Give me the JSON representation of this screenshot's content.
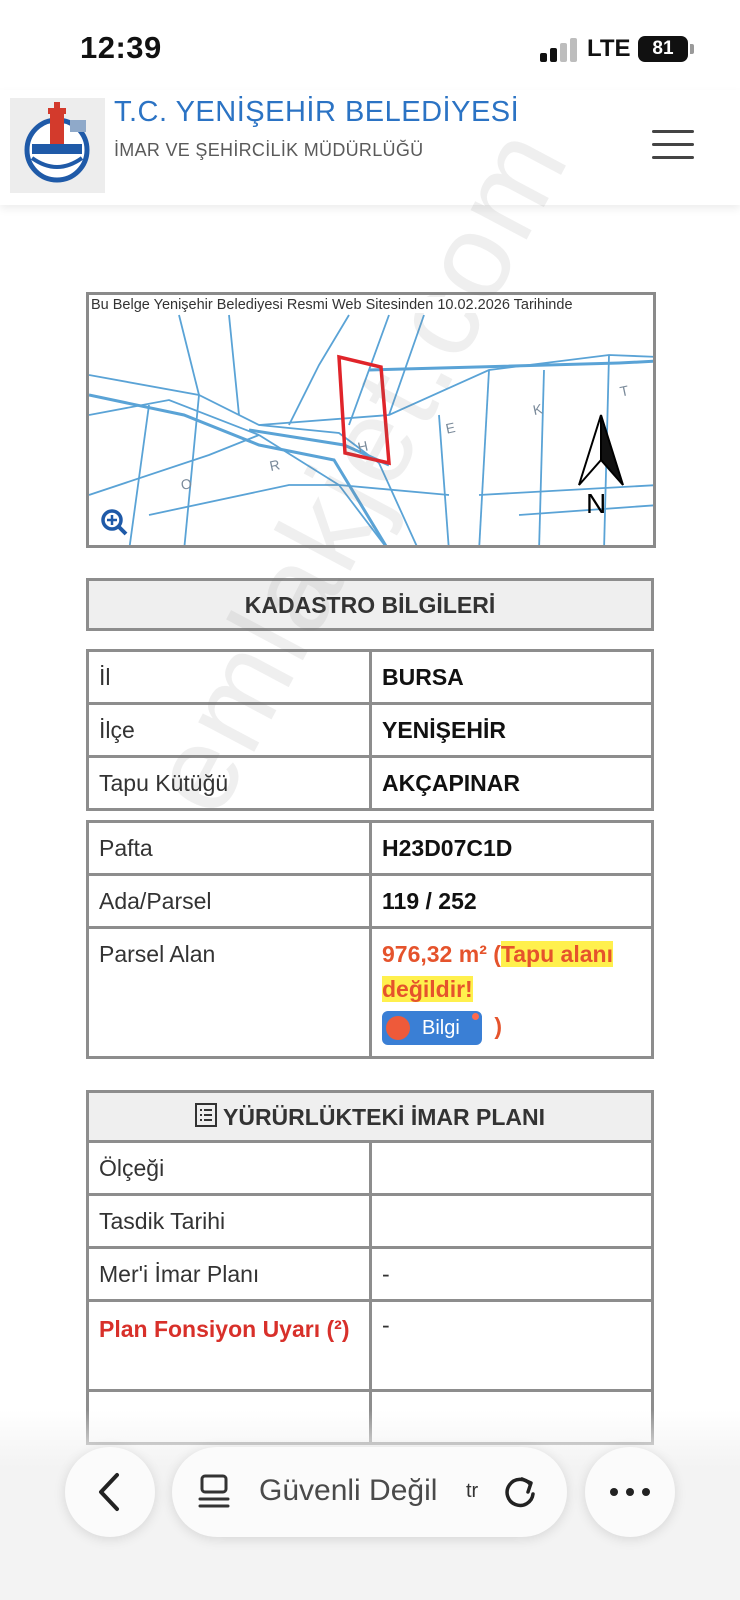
{
  "status_bar": {
    "time": "12:39",
    "network": "LTE",
    "battery": "81",
    "icons": [
      "signal-icon",
      "battery-icon"
    ]
  },
  "header": {
    "org_name": "T.C. YENİŞEHİR BELEDİYESİ",
    "org_sub": "İMAR VE ŞEHİRCİLİK MÜDÜRLÜĞÜ",
    "logo_text": "T.C. YENİŞEHİR BELEDİYESİ",
    "icons": [
      "logo-icon",
      "hamburger-menu-icon"
    ]
  },
  "map": {
    "caption": "Bu Belge Yenişehir Belediyesi Resmi Web Sitesinden 10.02.2026 Tarihinde",
    "north_label": "N",
    "road_label": "O R H E K T",
    "icons": [
      "zoom-in-icon",
      "north-arrow-icon"
    ]
  },
  "kadastro": {
    "title": "KADASTRO BİLGİLERİ",
    "location_rows": [
      {
        "label": "İl",
        "value": "BURSA"
      },
      {
        "label": "İlçe",
        "value": "YENİŞEHİR"
      },
      {
        "label": "Tapu Kütüğü",
        "value": "AKÇAPINAR"
      }
    ],
    "parcel_rows": [
      {
        "label": "Pafta",
        "value": "H23D07C1D"
      },
      {
        "label": "Ada/Parsel",
        "value": "119 / 252"
      }
    ],
    "area": {
      "label": "Parsel Alan",
      "value": "976,32 m²",
      "open_paren": "(",
      "note": "Tapu alanı değildir!",
      "button_label": "Bilgi",
      "close_paren": ")"
    }
  },
  "imar": {
    "title": "YÜRÜRLÜKTEKİ İMAR PLANI",
    "rows": [
      {
        "label": "Ölçeği",
        "value": ""
      },
      {
        "label": "Tasdik Tarihi",
        "value": ""
      },
      {
        "label": "Mer'i İmar Planı",
        "value": "-"
      }
    ],
    "warning_row": {
      "label": "Plan Fonsiyon Uyarı (²)",
      "value": "-"
    },
    "icons": [
      "list-icon"
    ]
  },
  "browser": {
    "url_text": "Güvenli Değil",
    "url_tld": "tr",
    "icons": [
      "back-icon",
      "page-menu-icon",
      "reload-icon",
      "more-icon"
    ]
  },
  "watermark": "emlakjet.com",
  "colors": {
    "header_blue": "#2b73c4",
    "warning_red": "#d8302a",
    "area_orange": "#e5532c",
    "highlight_yellow": "#fff04d",
    "button_blue": "#3a7fd5"
  }
}
